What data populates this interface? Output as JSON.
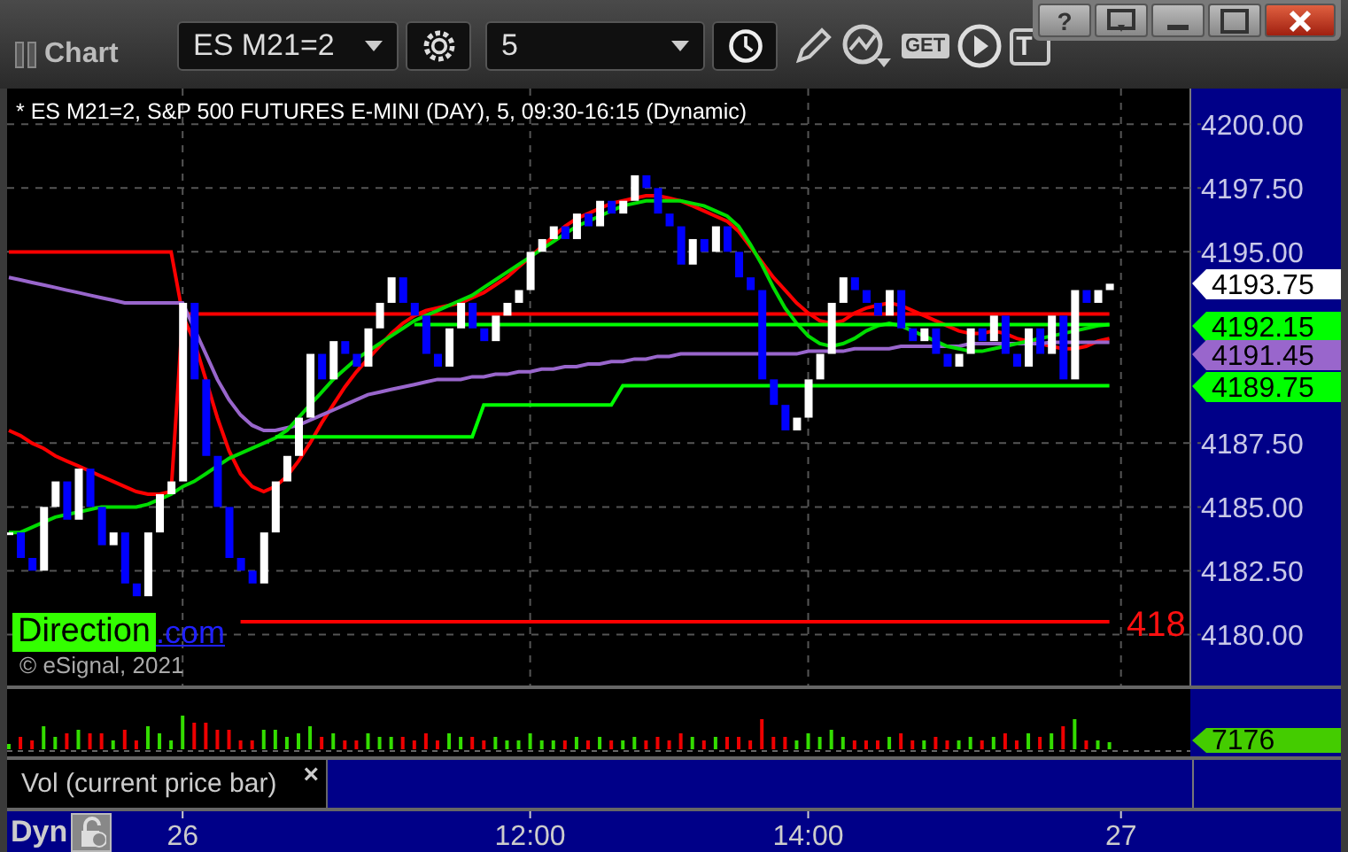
{
  "title_bar": {
    "title": "Chart",
    "window_buttons": [
      {
        "kind": "help",
        "label": "?"
      },
      {
        "kind": "restore"
      },
      {
        "kind": "minimize"
      },
      {
        "kind": "maximize"
      },
      {
        "kind": "close"
      }
    ]
  },
  "toolbar": [
    {
      "kind": "dropdown",
      "value": "ES M21=2"
    },
    {
      "kind": "settings"
    },
    {
      "kind": "dropdown",
      "value": "5"
    },
    {
      "kind": "clock"
    },
    {
      "kind": "pencil"
    },
    {
      "kind": "study"
    },
    {
      "kind": "get",
      "label": "GET"
    },
    {
      "kind": "play"
    },
    {
      "kind": "text",
      "label": "T"
    }
  ],
  "price_pane": {
    "header": "* ES M21=2, S&P 500 FUTURES E-MINI (DAY), 5, 09:30-16:15 (Dynamic)",
    "overlay_label": "Direction",
    "link": ".com",
    "cut_label": "418",
    "copyright": "© eSignal, 2021",
    "chart_data": {
      "type": "line",
      "grid": true,
      "series": [
        {
          "color": "#ff0000",
          "values": [
            4188,
            4187.8,
            4187.5,
            4187.3,
            4187,
            4186.8,
            4186.6,
            4186.4,
            4186.2,
            4186,
            4185.8,
            4185.6,
            4185.5,
            4185.5,
            4185.6,
            4192.5,
            4191.5,
            4190,
            4188.5,
            4187.2,
            4186.3,
            4185.8,
            4185.6,
            4185.8,
            4186.2,
            4186.8,
            4187.5,
            4188.3,
            4189,
            4189.7,
            4190.3,
            4190.8,
            4191.3,
            4191.8,
            4192.2,
            4192.5,
            4192.7,
            4192.8,
            4192.9,
            4193,
            4193.2,
            4193.4,
            4193.7,
            4194,
            4194.4,
            4194.8,
            4195.2,
            4195.6,
            4196,
            4196.3,
            4196.5,
            4196.7,
            4196.9,
            4197,
            4197.1,
            4197.2,
            4197.2,
            4197.1,
            4197,
            4196.8,
            4196.6,
            4196.4,
            4196.2,
            4195.8,
            4195.2,
            4194.6,
            4194,
            4193.5,
            4193,
            4192.6,
            4192.3,
            4192.2,
            4192.3,
            4192.6,
            4192.8,
            4192.9,
            4193,
            4192.9,
            4192.7,
            4192.5,
            4192.3,
            4192.1,
            4191.9,
            4191.8,
            4191.8,
            4191.9,
            4191.8,
            4191.6,
            4191.5,
            4191.4,
            4191.3,
            4191.2,
            4191.2,
            4191.3,
            4191.5,
            4191.6
          ]
        },
        {
          "color": "#ff0000",
          "values": [
            4195,
            4195,
            4195,
            4195,
            4195,
            4195,
            4195,
            4195,
            4195,
            4195,
            4195,
            4195,
            4195,
            4195,
            4195,
            4192.56,
            4192.56,
            4192.56,
            4192.56,
            4192.56,
            4192.56,
            4192.56,
            4192.56,
            4192.56,
            4192.56,
            4192.56,
            4192.56,
            4192.56,
            4192.56,
            4192.56,
            4192.56,
            4192.56,
            4192.56,
            4192.56,
            4192.56,
            4192.56,
            4192.56,
            4192.56,
            4192.56,
            4192.56,
            4192.56,
            4192.56,
            4192.56,
            4192.56,
            4192.56,
            4192.56,
            4192.56,
            4192.56,
            4192.56,
            4192.56,
            4192.56,
            4192.56,
            4192.56,
            4192.56,
            4192.56,
            4192.56,
            4192.56,
            4192.56,
            4192.56,
            4192.56,
            4192.56,
            4192.56,
            4192.56,
            4192.56,
            4192.56,
            4192.56,
            4192.56,
            4192.56,
            4192.56,
            4192.56,
            4192.56,
            4192.56,
            4192.56,
            4192.56,
            4192.56,
            4192.56,
            4192.56,
            4192.56,
            4192.56,
            4192.56,
            4192.56,
            4192.56,
            4192.56,
            4192.56,
            4192.56,
            4192.56,
            4192.56,
            4192.56,
            4192.56,
            4192.56,
            4192.56,
            4192.56,
            4192.56,
            4192.56,
            4192.56,
            4192.56
          ]
        },
        {
          "color": "#ff0000",
          "values": [
            null,
            null,
            null,
            null,
            null,
            null,
            null,
            null,
            null,
            null,
            null,
            null,
            null,
            null,
            null,
            null,
            null,
            null,
            null,
            null,
            4180.5,
            4180.5,
            4180.5,
            4180.5,
            4180.5,
            4180.5,
            4180.5,
            4180.5,
            4180.5,
            4180.5,
            4180.5,
            4180.5,
            4180.5,
            4180.5,
            4180.5,
            4180.5,
            4180.5,
            4180.5,
            4180.5,
            4180.5,
            4180.5,
            4180.5,
            4180.5,
            4180.5,
            4180.5,
            4180.5,
            4180.5,
            4180.5,
            4180.5,
            4180.5,
            4180.5,
            4180.5,
            4180.5,
            4180.5,
            4180.5,
            4180.5,
            4180.5,
            4180.5,
            4180.5,
            4180.5,
            4180.5,
            4180.5,
            4180.5,
            4180.5,
            4180.5,
            4180.5,
            4180.5,
            4180.5,
            4180.5,
            4180.5,
            4180.5,
            4180.5,
            4180.5,
            4180.5,
            4180.5,
            4180.5,
            4180.5,
            4180.5,
            4180.5,
            4180.5,
            4180.5,
            4180.5,
            4180.5,
            4180.5,
            4180.5,
            4180.5,
            4180.5,
            4180.5,
            4180.5,
            4180.5,
            4180.5,
            4180.5,
            4180.5,
            4180.5,
            4180.5,
            4180.5
          ]
        },
        {
          "color": "#9966cc",
          "values": [
            4194,
            4193.9,
            4193.8,
            4193.7,
            4193.6,
            4193.5,
            4193.4,
            4193.3,
            4193.2,
            4193.1,
            4193,
            4193,
            4193,
            4193,
            4193,
            4193,
            4192,
            4191,
            4190,
            4189.2,
            4188.6,
            4188.2,
            4188,
            4188,
            4188.1,
            4188.2,
            4188.4,
            4188.6,
            4188.8,
            4189,
            4189.2,
            4189.4,
            4189.5,
            4189.6,
            4189.7,
            4189.8,
            4189.9,
            4190,
            4190,
            4190,
            4190.1,
            4190.1,
            4190.2,
            4190.2,
            4190.3,
            4190.3,
            4190.4,
            4190.4,
            4190.5,
            4190.5,
            4190.6,
            4190.6,
            4190.7,
            4190.7,
            4190.8,
            4190.8,
            4190.9,
            4190.9,
            4191,
            4191,
            4191,
            4191,
            4191,
            4191,
            4191,
            4191,
            4191,
            4191,
            4191,
            4191.1,
            4191.1,
            4191.1,
            4191.1,
            4191.2,
            4191.2,
            4191.2,
            4191.2,
            4191.3,
            4191.3,
            4191.3,
            4191.3,
            4191.3,
            4191.3,
            4191.4,
            4191.4,
            4191.4,
            4191.4,
            4191.4,
            4191.4,
            4191.4,
            4191.45,
            4191.45,
            4191.45,
            4191.45,
            4191.45,
            4191.45
          ]
        },
        {
          "color": "#00dd00",
          "values": [
            4184,
            4184,
            4184.2,
            4184.4,
            4184.6,
            4184.7,
            4184.8,
            4184.9,
            4185,
            4185,
            4185,
            4185,
            4185.1,
            4185.3,
            4185.5,
            4185.8,
            4186,
            4186.3,
            4186.6,
            4186.9,
            4187.1,
            4187.3,
            4187.5,
            4187.7,
            4188,
            4188.5,
            4189,
            4189.5,
            4190,
            4190.4,
            4190.8,
            4191.1,
            4191.4,
            4191.7,
            4192,
            4192.3,
            4192.5,
            4192.7,
            4192.9,
            4193.1,
            4193.3,
            4193.6,
            4193.9,
            4194.2,
            4194.5,
            4194.8,
            4195.1,
            4195.4,
            4195.7,
            4196,
            4196.2,
            4196.4,
            4196.6,
            4196.8,
            4196.9,
            4197,
            4197,
            4197,
            4197,
            4196.9,
            4196.8,
            4196.6,
            4196.4,
            4196,
            4195.3,
            4194.5,
            4193.6,
            4192.8,
            4192.2,
            4191.7,
            4191.4,
            4191.3,
            4191.4,
            4191.6,
            4191.9,
            4192.1,
            4192.2,
            4192.1,
            4191.9,
            4191.7,
            4191.5,
            4191.3,
            4191.2,
            4191.1,
            4191.1,
            4191.2,
            4191.3,
            4191.4,
            4191.5,
            4191.6,
            4191.7,
            4191.8,
            4191.9,
            4192,
            4192.1,
            4192.15
          ]
        },
        {
          "color": "#00ff00",
          "values": [
            null,
            null,
            null,
            null,
            null,
            null,
            null,
            null,
            null,
            null,
            null,
            null,
            null,
            null,
            null,
            null,
            null,
            null,
            null,
            null,
            null,
            null,
            null,
            null,
            null,
            null,
            null,
            null,
            null,
            null,
            null,
            null,
            null,
            null,
            null,
            4192.15,
            4192.15,
            4192.15,
            4192.15,
            4192.15,
            4192.15,
            4192.15,
            4192.15,
            4192.15,
            4192.15,
            4192.15,
            4192.15,
            4192.15,
            4192.15,
            4192.15,
            4192.15,
            4192.15,
            4192.15,
            4192.15,
            4192.15,
            4192.15,
            4192.15,
            4192.15,
            4192.15,
            4192.15,
            4192.15,
            4192.15,
            4192.15,
            4192.15,
            4192.15,
            4192.15,
            4192.15,
            4192.15,
            4192.15,
            4192.15,
            4192.15,
            4192.15,
            4192.15,
            4192.15,
            4192.15,
            4192.15,
            4192.15,
            4192.15,
            4192.15,
            4192.15,
            4192.15,
            4192.15,
            4192.15,
            4192.15,
            4192.15,
            4192.15,
            4192.15,
            4192.15,
            4192.15,
            4192.15,
            4192.15,
            4192.15,
            4192.15,
            4192.15,
            4192.15,
            4192.15
          ]
        },
        {
          "color": "#00ff00",
          "values": [
            null,
            null,
            null,
            null,
            null,
            null,
            null,
            null,
            null,
            null,
            null,
            null,
            null,
            null,
            null,
            null,
            null,
            null,
            null,
            null,
            null,
            null,
            null,
            4187.75,
            4187.75,
            4187.75,
            4187.75,
            4187.75,
            4187.75,
            4187.75,
            4187.75,
            4187.75,
            4187.75,
            4187.75,
            4187.75,
            4187.75,
            4187.75,
            4187.75,
            4187.75,
            4187.75,
            4187.75,
            4189,
            4189,
            4189,
            4189,
            4189,
            4189,
            4189,
            4189,
            4189,
            4189,
            4189,
            4189,
            4189.75,
            4189.75,
            4189.75,
            4189.75,
            4189.75,
            4189.75,
            4189.75,
            4189.75,
            4189.75,
            4189.75,
            4189.75,
            4189.75,
            4189.75,
            4189.75,
            4189.75,
            4189.75,
            4189.75,
            4189.75,
            4189.75,
            4189.75,
            4189.75,
            4189.75,
            4189.75,
            4189.75,
            4189.75,
            4189.75,
            4189.75,
            4189.75,
            4189.75,
            4189.75,
            4189.75,
            4189.75,
            4189.75,
            4189.75,
            4189.75,
            4189.75,
            4189.75,
            4189.75,
            4189.75,
            4189.75,
            4189.75,
            4189.75,
            4189.75
          ]
        }
      ],
      "ylim": [
        4178,
        4201.4
      ],
      "yticks": [
        {
          "value": 4200,
          "label": "4200.00"
        },
        {
          "value": 4197.5,
          "label": "4197.50"
        },
        {
          "value": 4195,
          "label": "4195.00"
        },
        {
          "value": 4187.5,
          "label": "4187.50"
        },
        {
          "value": 4185,
          "label": "4185.00"
        },
        {
          "value": 4182.5,
          "label": "4182.50"
        },
        {
          "value": 4180,
          "label": "4180.00"
        }
      ]
    },
    "price_flags": [
      {
        "label": "4193.75",
        "color": "#ffffff"
      },
      {
        "label": "4192.15",
        "color": "#00ff00"
      },
      {
        "label": "4191.45",
        "color": "#9966cc"
      },
      {
        "label": "4189.75",
        "color": "#00ff00"
      }
    ]
  },
  "volume_pane": {
    "label": "Vol (current price bar)",
    "close": "×",
    "flag": "7176"
  },
  "time_axis": {
    "mode": "Dyn",
    "labels": [
      "26",
      "12:00",
      "14:00",
      "27"
    ]
  }
}
